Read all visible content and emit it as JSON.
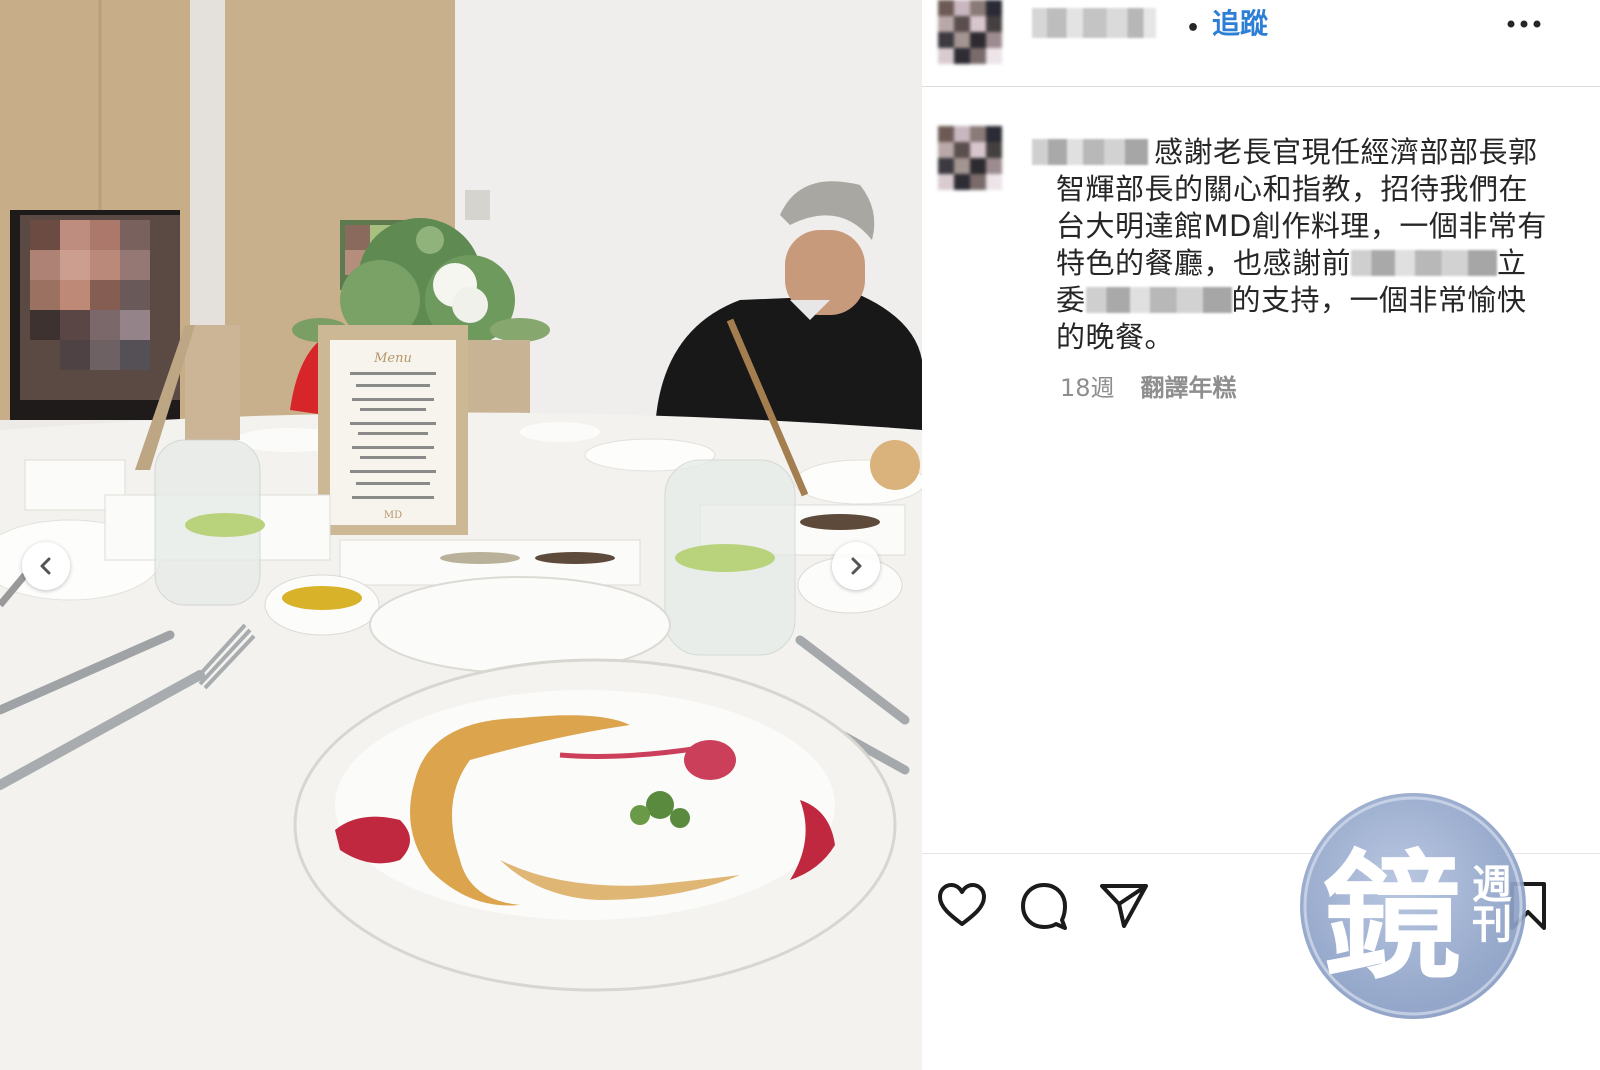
{
  "post": {
    "follow_separator": "•",
    "follow_label": "追蹤",
    "caption": {
      "line1": "感謝老長官現任經濟部部長郭",
      "line2": "智輝部長的關心和指教，招待我們在",
      "line3": "台大明達館MD創作料理，一個非常有",
      "line4_a": "特色的餐廳，也感謝前",
      "line4_b": "立",
      "line5_a": "委",
      "line5_b": "的支持，一個非常愉快",
      "line6": "的晚餐。"
    },
    "time_ago": "18週",
    "translate_label": "翻譯年糕"
  },
  "photo": {
    "menu_card": {
      "title": "Menu",
      "logo": "MD"
    }
  },
  "watermark": {
    "main_char": "鏡",
    "side_chars": "週刊"
  },
  "icons": {
    "prev": "chevron-left-icon",
    "next": "chevron-right-icon",
    "more": "more-horizontal-icon",
    "like": "heart-icon",
    "comment": "comment-icon",
    "share": "paper-plane-icon",
    "save": "bookmark-icon"
  },
  "colors": {
    "link_blue": "#2d7fd6",
    "text": "#262626",
    "muted": "#8e8e8e",
    "watermark_blue": "#8fa3c8"
  }
}
